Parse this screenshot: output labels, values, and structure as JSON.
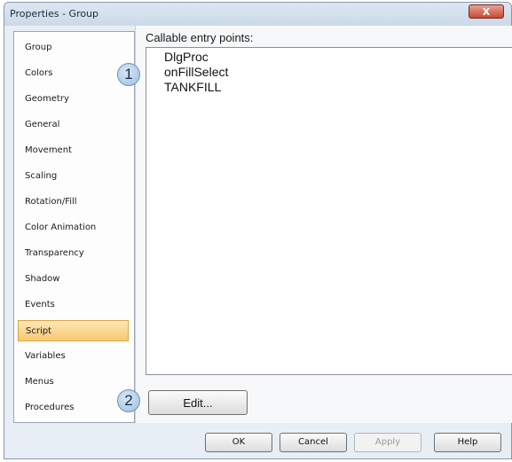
{
  "window": {
    "title": "Properties - Group",
    "close_label": "X"
  },
  "sidebar": {
    "items": [
      {
        "label": "Group"
      },
      {
        "label": "Colors"
      },
      {
        "label": "Geometry"
      },
      {
        "label": "General"
      },
      {
        "label": "Movement"
      },
      {
        "label": "Scaling"
      },
      {
        "label": "Rotation/Fill"
      },
      {
        "label": "Color Animation"
      },
      {
        "label": "Transparency"
      },
      {
        "label": "Shadow"
      },
      {
        "label": "Events"
      },
      {
        "label": "Script"
      },
      {
        "label": "Variables"
      },
      {
        "label": "Menus"
      },
      {
        "label": "Procedures"
      }
    ],
    "selected": "Script"
  },
  "panel": {
    "label": "Callable entry points:",
    "entries": [
      "DlgProc",
      "onFillSelect",
      "TANKFILL"
    ],
    "edit_label": "Edit..."
  },
  "callouts": [
    "1",
    "2"
  ],
  "buttons": {
    "ok": "OK",
    "cancel": "Cancel",
    "apply": "Apply",
    "help": "Help"
  },
  "colors": {
    "selection": "#f6c872",
    "close": "#c84a33",
    "callout": "#9fbfdf"
  }
}
